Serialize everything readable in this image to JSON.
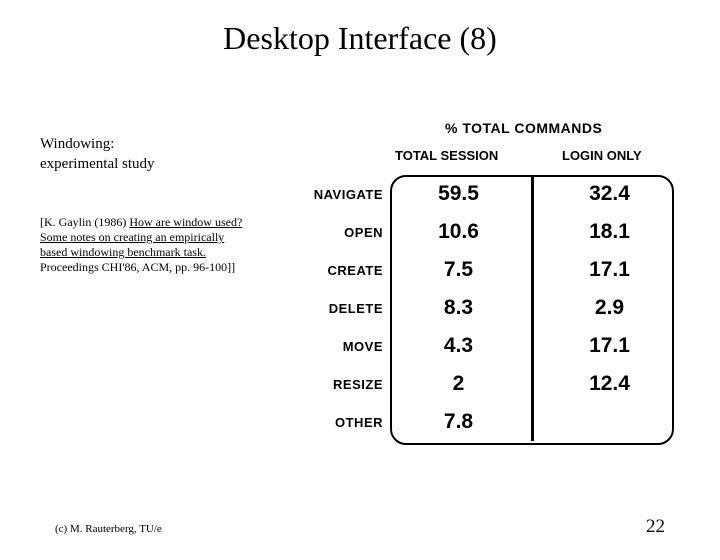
{
  "title": "Desktop Interface (8)",
  "subtitle": {
    "line1": "Windowing:",
    "line2": "experimental study"
  },
  "citation": {
    "prefix": "[K. Gaylin (1986) ",
    "link": "How are window used? Some notes on creating an empirically based windowing benchmark task.",
    "suffix": " Proceedings CHI'86, ACM, pp. 96-100]]"
  },
  "footer": {
    "left": "(c) M. Rauterberg, TU/e",
    "right": "22"
  },
  "chart_data": {
    "type": "table",
    "title": "% TOTAL COMMANDS",
    "columns": [
      "TOTAL SESSION",
      "LOGIN ONLY"
    ],
    "rows": [
      {
        "label": "NAVIGATE",
        "values": [
          59.5,
          32.4
        ]
      },
      {
        "label": "OPEN",
        "values": [
          10.6,
          18.1
        ]
      },
      {
        "label": "CREATE",
        "values": [
          7.5,
          17.1
        ]
      },
      {
        "label": "DELETE",
        "values": [
          8.3,
          2.9
        ]
      },
      {
        "label": "MOVE",
        "values": [
          4.3,
          17.1
        ]
      },
      {
        "label": "RESIZE",
        "values": [
          2.0,
          12.4
        ]
      },
      {
        "label": "OTHER",
        "values": [
          7.8,
          null
        ]
      }
    ]
  }
}
